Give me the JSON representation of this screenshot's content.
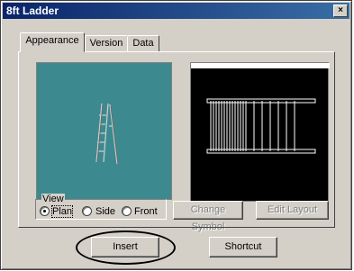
{
  "window": {
    "title": "8ft Ladder",
    "close_glyph": "×"
  },
  "tabs": [
    {
      "label": "Appearance",
      "active": true
    },
    {
      "label": "Version",
      "active": false
    },
    {
      "label": "Data",
      "active": false
    }
  ],
  "view_group": {
    "legend": "View",
    "options": [
      {
        "label": "Plan",
        "checked": true
      },
      {
        "label": "Side",
        "checked": false
      },
      {
        "label": "Front",
        "checked": false
      }
    ]
  },
  "buttons": {
    "change_symbol": "Change Symbol",
    "edit_layout": "Edit Layout",
    "insert": "Insert",
    "shortcut": "Shortcut"
  },
  "colors": {
    "plan_preview_bg": "#3c8a90",
    "side_preview_bg": "#000000",
    "dialog_face": "#d4d0c8",
    "title_bar": "#0a246a"
  }
}
